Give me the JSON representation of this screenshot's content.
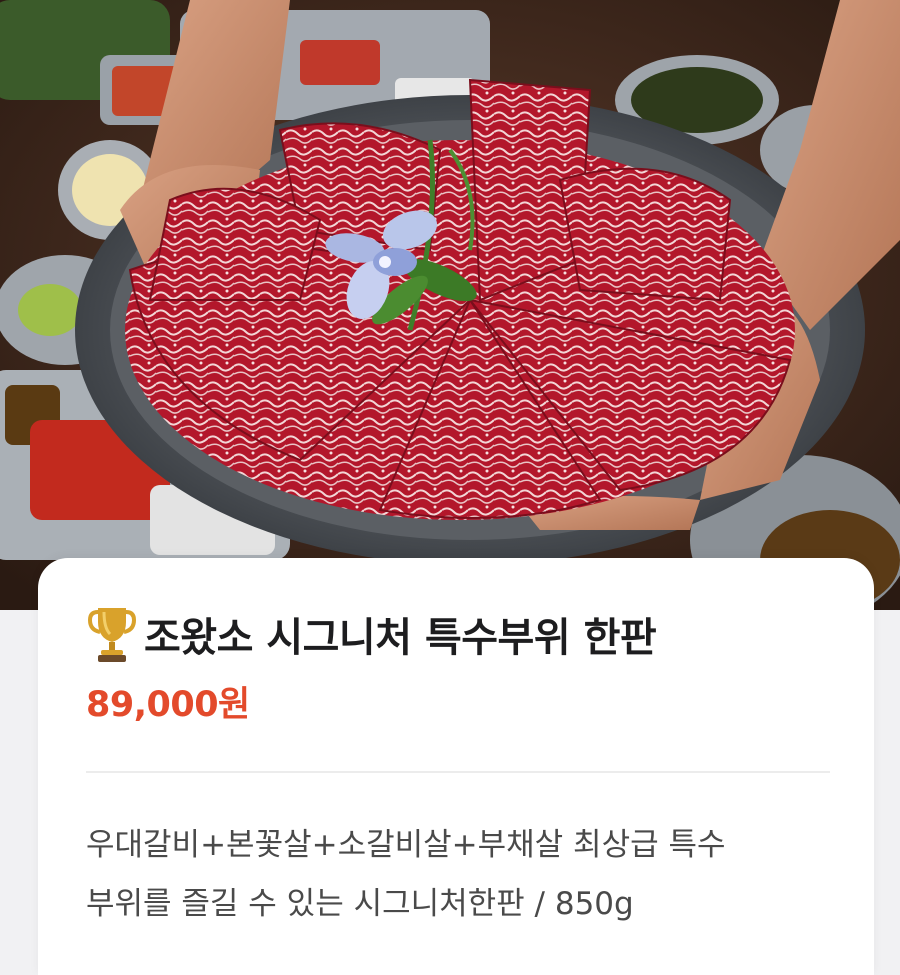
{
  "product": {
    "title": "조왔소 시그니처 특수부위 한판",
    "price": "89,000원",
    "description_line1": "우대갈비+본꽃살+소갈비살+부채살 최상급 특수",
    "description_line2": "부위를 즐길 수 있는 시그니처한판 / 850g"
  },
  "colors": {
    "price": "#e34a2b",
    "title": "#1d1d1f",
    "description": "#4a4a4a",
    "meat": "#b3172b"
  },
  "icons": {
    "title_icon": "trophy-icon"
  }
}
